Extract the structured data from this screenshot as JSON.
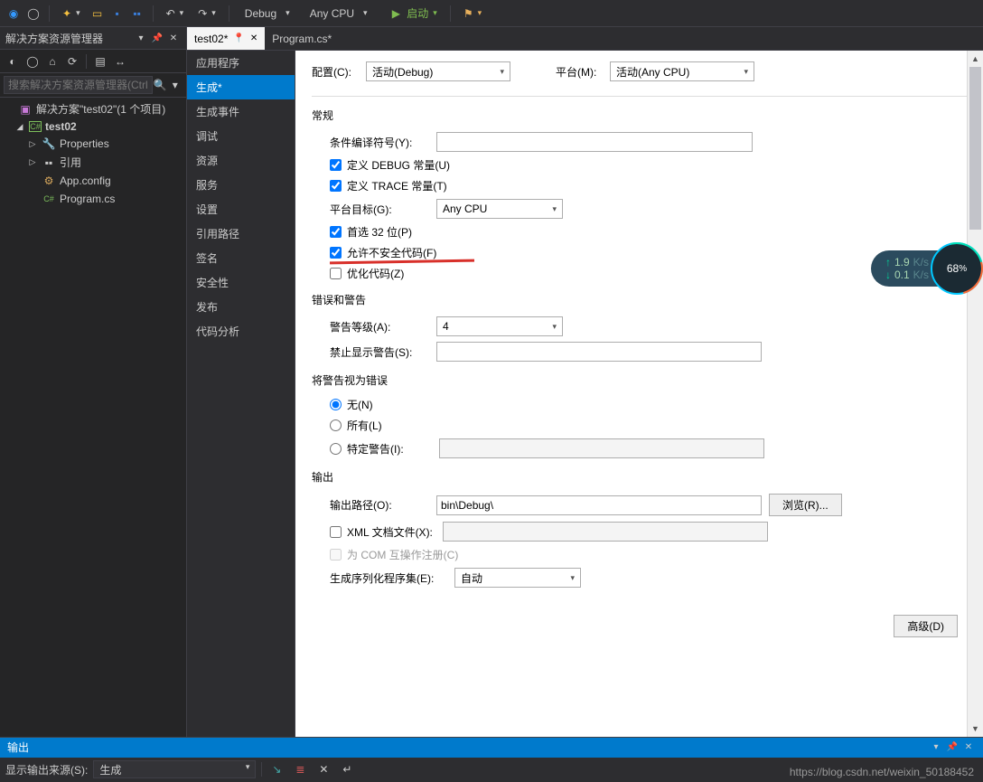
{
  "toolbar": {
    "config": "Debug",
    "platform": "Any CPU",
    "start_label": "启动"
  },
  "solution_explorer": {
    "title": "解决方案资源管理器",
    "search_placeholder": "搜索解决方案资源管理器(Ctrl",
    "solution_label": "解决方案\"test02\"(1 个项目)",
    "project": "test02",
    "properties": "Properties",
    "references": "引用",
    "app_config": "App.config",
    "program_cs": "Program.cs"
  },
  "tabs": {
    "t1": "test02*",
    "t2": "Program.cs*"
  },
  "nav": {
    "app": "应用程序",
    "build": "生成*",
    "build_events": "生成事件",
    "debug": "调试",
    "resources": "资源",
    "services": "服务",
    "settings": "设置",
    "ref_paths": "引用路径",
    "signing": "签名",
    "security": "安全性",
    "publish": "发布",
    "code_analysis": "代码分析"
  },
  "props": {
    "config_label": "配置(C):",
    "config_value": "活动(Debug)",
    "platform_label": "平台(M):",
    "platform_value": "活动(Any CPU)",
    "section_general": "常规",
    "cond_symbols_label": "条件编译符号(Y):",
    "define_debug": "定义 DEBUG 常量(U)",
    "define_trace": "定义 TRACE 常量(T)",
    "platform_target_label": "平台目标(G):",
    "platform_target_value": "Any CPU",
    "prefer32": "首选 32 位(P)",
    "allow_unsafe": "允许不安全代码(F)",
    "optimize": "优化代码(Z)",
    "section_errors": "错误和警告",
    "warn_level_label": "警告等级(A):",
    "warn_level_value": "4",
    "suppress_label": "禁止显示警告(S):",
    "section_treat": "将警告视为错误",
    "treat_none": "无(N)",
    "treat_all": "所有(L)",
    "treat_specific": "特定警告(I):",
    "section_output": "输出",
    "output_path_label": "输出路径(O):",
    "output_path_value": "bin\\Debug\\",
    "browse": "浏览(R)...",
    "xml_doc": "XML 文档文件(X):",
    "com_interop": "为 COM 互操作注册(C)",
    "serialization_label": "生成序列化程序集(E):",
    "serialization_value": "自动",
    "advanced": "高级(D)"
  },
  "output": {
    "title": "输出",
    "show_from": "显示输出来源(S):",
    "source": "生成"
  },
  "net": {
    "up": "1.9",
    "down": "0.1",
    "unit": "K/s",
    "pct": "68",
    "pct_sym": "%"
  },
  "watermark": "https://blog.csdn.net/weixin_50188452"
}
